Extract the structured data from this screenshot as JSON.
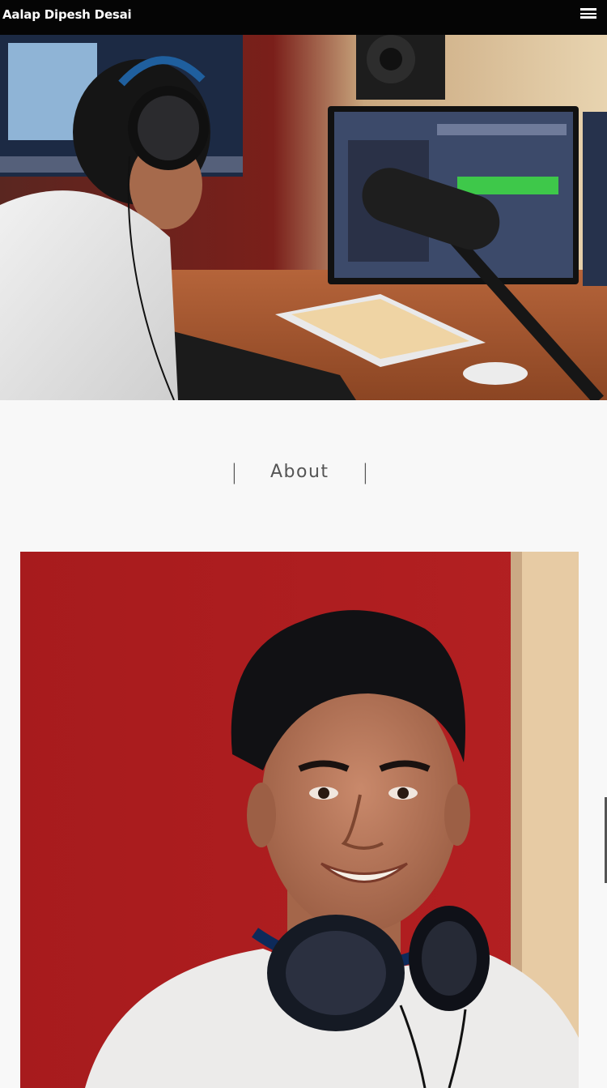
{
  "header": {
    "site_title": "Aalap Dipesh Desai",
    "menu_icon": "hamburger-menu-icon"
  },
  "about": {
    "separator_left": "|",
    "heading": "About",
    "separator_right": "|"
  },
  "colors": {
    "header_bg": "#050505",
    "page_bg": "#f8f8f8",
    "heading_text": "#555555",
    "portrait_wall": "#a71b1d"
  }
}
